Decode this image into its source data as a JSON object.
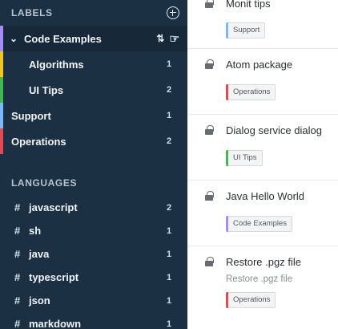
{
  "labels_section": {
    "title": "LABELS",
    "items": [
      {
        "label": "Code Examples",
        "count": "",
        "color": "#a78bfa",
        "level": "parent",
        "expanded": true
      },
      {
        "label": "Algorithms",
        "count": "1",
        "color": "#f5c518",
        "level": "child"
      },
      {
        "label": "UI Tips",
        "count": "2",
        "color": "#3fb950",
        "level": "child"
      },
      {
        "label": "Support",
        "count": "1",
        "color": "#79b8ff",
        "level": "top"
      },
      {
        "label": "Operations",
        "count": "2",
        "color": "#e5484d",
        "level": "top"
      }
    ]
  },
  "languages_section": {
    "title": "LANGUAGES",
    "items": [
      {
        "label": "javascript",
        "count": "2"
      },
      {
        "label": "sh",
        "count": "1"
      },
      {
        "label": "java",
        "count": "1"
      },
      {
        "label": "typescript",
        "count": "1"
      },
      {
        "label": "json",
        "count": "1"
      },
      {
        "label": "markdown",
        "count": "1"
      }
    ]
  },
  "snippets": [
    {
      "title": "Monit tips",
      "subtitle": "",
      "tag": "Support",
      "tag_color": "#79b8ff"
    },
    {
      "title": "Atom package",
      "subtitle": "",
      "tag": "Operations",
      "tag_color": "#e5484d"
    },
    {
      "title": "Dialog service dialog",
      "subtitle": "",
      "tag": "UI Tips",
      "tag_color": "#3fb950"
    },
    {
      "title": "Java Hello World",
      "subtitle": "",
      "tag": "Code Examples",
      "tag_color": "#a78bfa"
    },
    {
      "title": "Restore .pgz file",
      "subtitle": "Restore .pgz file",
      "tag": "Operations",
      "tag_color": "#e5484d"
    }
  ],
  "icons": {
    "add": "plus-circle-icon",
    "chevron": "chevron-down-icon",
    "sort": "sort-icon",
    "cursor": "hand-pointer-icon",
    "lock": "lock-icon",
    "hash": "hash-icon"
  }
}
